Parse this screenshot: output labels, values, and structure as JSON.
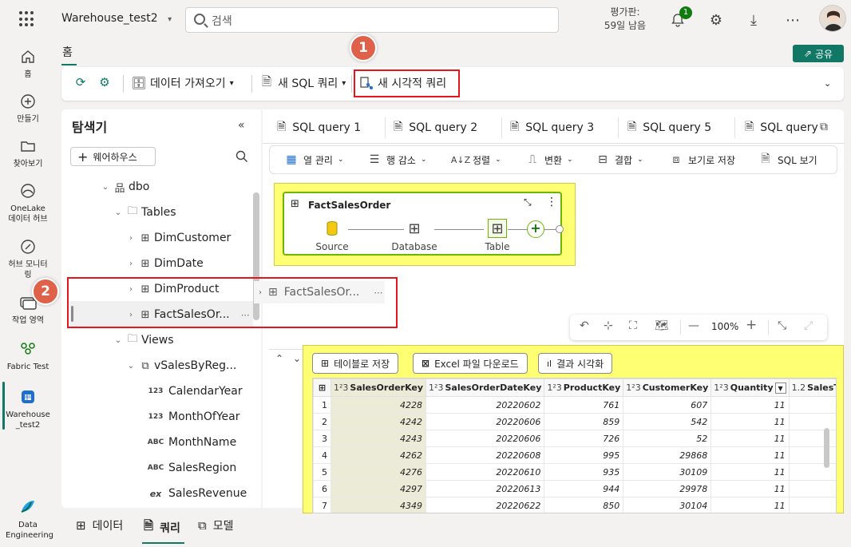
{
  "topbar": {
    "workspace_name": "Warehouse_test2",
    "search_placeholder": "검색",
    "trial_line1": "평가판:",
    "trial_line2": "59일 남음",
    "notification_count": "1"
  },
  "rail": {
    "items": [
      {
        "label": "홈",
        "icon": "home-icon"
      },
      {
        "label": "만들기",
        "icon": "create-icon"
      },
      {
        "label": "찾아보기",
        "icon": "folder-icon"
      },
      {
        "label": "OneLake 데이터 허브",
        "icon": "onelake-icon"
      },
      {
        "label": "허브 모니터링",
        "icon": "monitor-icon"
      },
      {
        "label": "작업 영역",
        "icon": "workspace-icon"
      },
      {
        "label": "Fabric Test",
        "icon": "group-icon"
      },
      {
        "label": "Warehouse_test2",
        "icon": "warehouse-icon"
      },
      {
        "label": "Data Engineering",
        "icon": "fabric-logo-icon"
      }
    ]
  },
  "home_tab": "홈",
  "share_label": "공유",
  "ribbon": {
    "get_data": "데이터 가져오기",
    "new_sql_query": "새 SQL 쿼리",
    "new_visual_query": "새 시각적 쿼리"
  },
  "annotations": [
    "1",
    "2"
  ],
  "explorer": {
    "title": "탐색기",
    "add_warehouse": "웨어하우스",
    "tree": [
      {
        "label": "dbo",
        "kind": "schema"
      },
      {
        "label": "Tables",
        "kind": "folder"
      },
      {
        "label": "DimCustomer",
        "kind": "table"
      },
      {
        "label": "DimDate",
        "kind": "table"
      },
      {
        "label": "DimProduct",
        "kind": "table"
      },
      {
        "label": "FactSalesOr...",
        "kind": "table"
      },
      {
        "label": "Views",
        "kind": "folder"
      },
      {
        "label": "vSalesByReg...",
        "kind": "view"
      },
      {
        "label": "CalendarYear",
        "kind": "column",
        "type": "123"
      },
      {
        "label": "MonthOfYear",
        "kind": "column",
        "type": "123"
      },
      {
        "label": "MonthName",
        "kind": "column",
        "type": "ABC"
      },
      {
        "label": "SalesRegion",
        "kind": "column",
        "type": "ABC"
      },
      {
        "label": "SalesRevenue",
        "kind": "column",
        "type": "ex"
      }
    ],
    "drag_ghost": "FactSalesOr..."
  },
  "query_tabs": [
    "SQL query 1",
    "SQL query 2",
    "SQL query 3",
    "SQL query 5",
    "SQL query"
  ],
  "toolbar": {
    "manage_columns": "열 관리",
    "reduce_rows": "행 감소",
    "sort": "정렬",
    "transform": "변환",
    "combine": "결합",
    "save_as_view": "보기로 저장",
    "view_sql": "SQL 보기"
  },
  "diagram": {
    "card_title": "FactSalesOrder",
    "steps": [
      "Source",
      "Database",
      "Table"
    ],
    "zoom": "100%"
  },
  "results": {
    "save_as_table": "테이블로 저장",
    "download_excel": "Excel 파일 다운로드",
    "visualize": "결과 시각화",
    "columns": [
      {
        "type": "1²3",
        "name": "SalesOrderKey"
      },
      {
        "type": "1²3",
        "name": "SalesOrderDateKey"
      },
      {
        "type": "1²3",
        "name": "ProductKey"
      },
      {
        "type": "1²3",
        "name": "CustomerKey"
      },
      {
        "type": "1²3",
        "name": "Quantity"
      },
      {
        "type": "1.2",
        "name": "SalesTo"
      }
    ],
    "rows": [
      [
        "1",
        "4228",
        "20220602",
        "761",
        "607",
        "11"
      ],
      [
        "2",
        "4242",
        "20220606",
        "859",
        "542",
        "11"
      ],
      [
        "3",
        "4243",
        "20220606",
        "726",
        "52",
        "11"
      ],
      [
        "4",
        "4262",
        "20220608",
        "995",
        "29868",
        "11"
      ],
      [
        "5",
        "4276",
        "20220610",
        "935",
        "30109",
        "11"
      ],
      [
        "6",
        "4297",
        "20220613",
        "944",
        "29978",
        "11"
      ],
      [
        "7",
        "4349",
        "20220622",
        "850",
        "30104",
        "11"
      ]
    ]
  },
  "bottom_tabs": [
    "데이터",
    "쿼리",
    "모델"
  ],
  "colors": {
    "accent": "#117865",
    "annotation_red": "#e8141c",
    "highlight_yellow": "#ffff73"
  }
}
